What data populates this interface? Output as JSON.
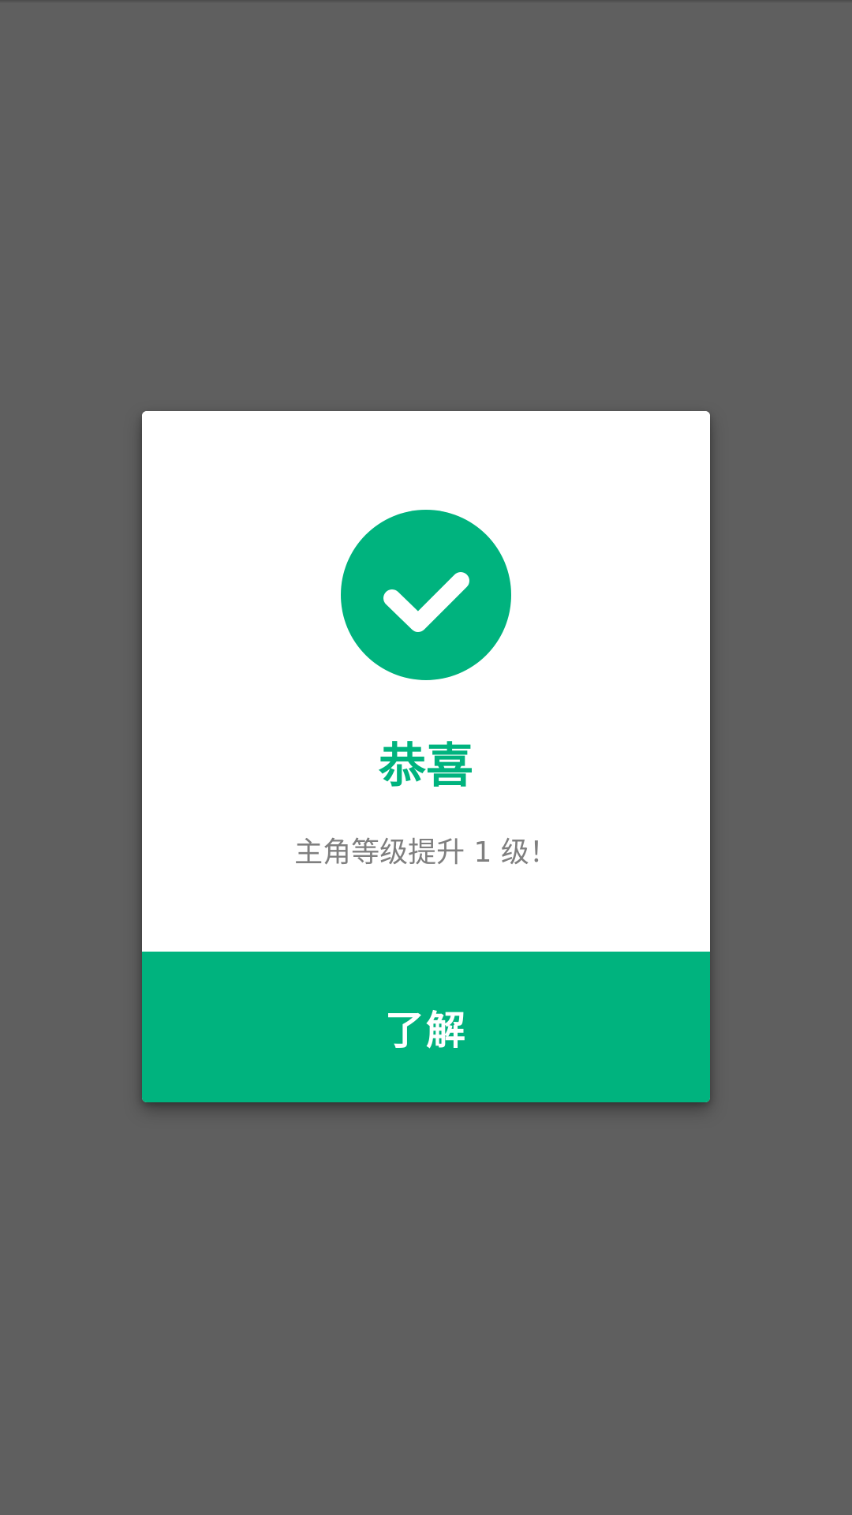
{
  "dialog": {
    "icon": "check-circle-icon",
    "title": "恭喜",
    "message": "主角等级提升 1 级！",
    "confirm_label": "了解"
  },
  "colors": {
    "accent": "#00b37e",
    "overlay": "#5f5f5f",
    "message_text": "#7f7f7f",
    "dialog_background": "#ffffff"
  }
}
